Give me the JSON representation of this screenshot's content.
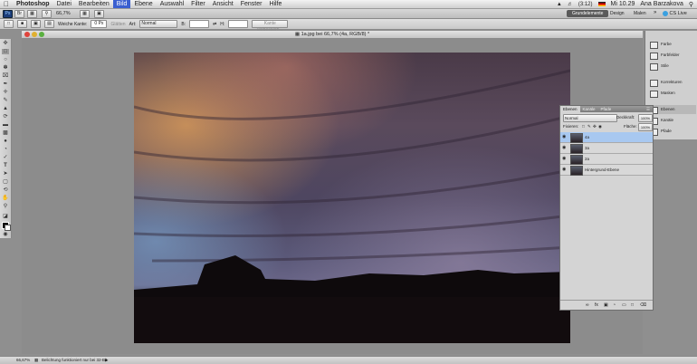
{
  "menubar": {
    "app_name": "Photoshop",
    "items": [
      "Datei",
      "Bearbeiten",
      "Bild",
      "Ebene",
      "Auswahl",
      "Filter",
      "Ansicht",
      "Fenster",
      "Hilfe"
    ],
    "active_item": "Bild",
    "battery": "(3:12)",
    "clock": "Mi 10.29",
    "user": "Ana Barzakova"
  },
  "appbar": {
    "zoom": "66,7%",
    "workspaces": [
      "Grundelemente",
      "Design",
      "Malen"
    ],
    "active_workspace": "Grundelemente",
    "cs_live": "CS Live"
  },
  "options": {
    "weiche_kante_label": "Weiche Kante:",
    "weiche_kante_value": "0 Px",
    "glaetten": "Glätten",
    "art_label": "Art:",
    "art_value": "Normal",
    "b_label": "B:",
    "h_label": "H:",
    "kante_button": "Kante verbessern..."
  },
  "document": {
    "title": "1a.jpg bei 66,7% (4a, RGB/8) *"
  },
  "layers_panel": {
    "tabs": [
      "Ebenen",
      "Kanäle",
      "Pfade"
    ],
    "active_tab": "Ebenen",
    "blend_mode": "Normal",
    "opacity_label": "Deckkraft:",
    "opacity_value": "100%",
    "fix_label": "Fixieren:",
    "fill_label": "Fläche:",
    "fill_value": "100%",
    "layers": [
      {
        "name": "4a",
        "selected": true
      },
      {
        "name": "3a",
        "selected": false
      },
      {
        "name": "2a",
        "selected": false
      },
      {
        "name": "Hintergrund-Ebene",
        "selected": false
      }
    ]
  },
  "dock": {
    "group1": [
      "Farbe",
      "Farbfelder",
      "Stile"
    ],
    "group2": [
      "Korrekturen",
      "Masken"
    ],
    "group3": [
      "Ebenen",
      "Kanäle",
      "Pfade"
    ],
    "active": "Ebenen"
  },
  "status": {
    "zoom": "66,67%",
    "message": "Belichtung funktioniert nur bei 32-Bit"
  },
  "colors": {
    "accent": "#3a5fd0",
    "selection": "#a8c8f0",
    "panel": "#d4d4d4"
  }
}
